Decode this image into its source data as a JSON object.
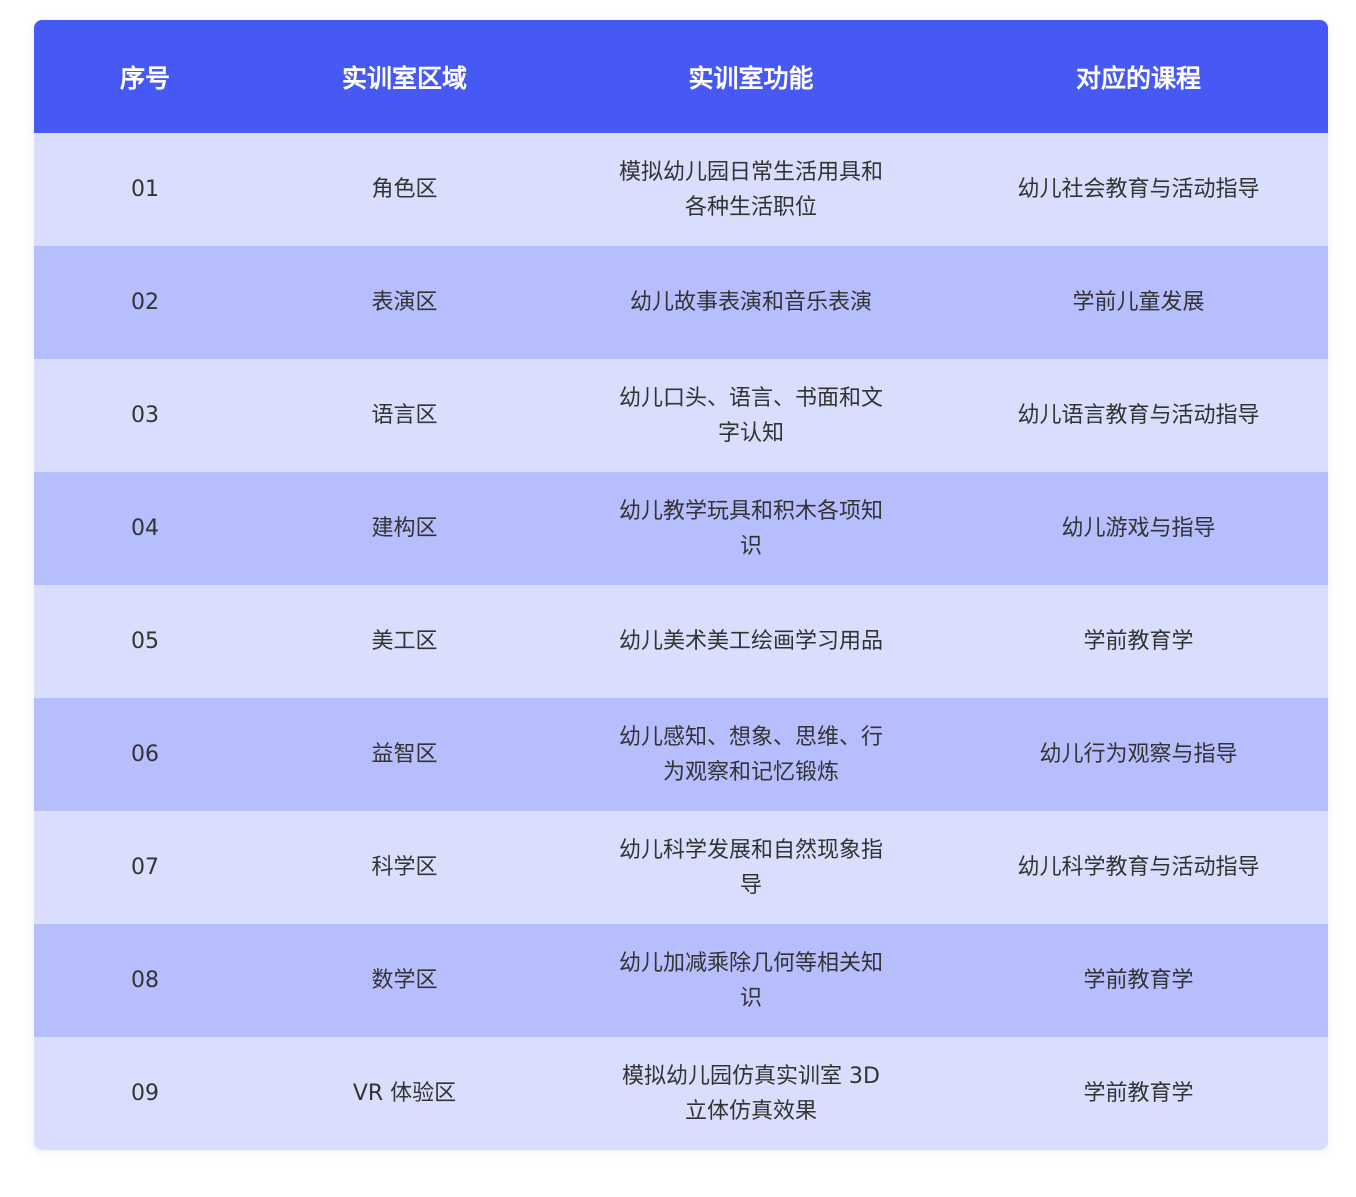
{
  "header": {
    "col_index": "序号",
    "col_area": "实训室区域",
    "col_function": "实训室功能",
    "col_course": "对应的课程"
  },
  "rows": [
    {
      "index": "01",
      "area": "角色区",
      "function": "模拟幼儿园日常生活用具和各种生活职位",
      "course": "幼儿社会教育与活动指导"
    },
    {
      "index": "02",
      "area": "表演区",
      "function": "幼儿故事表演和音乐表演",
      "course": "学前儿童发展"
    },
    {
      "index": "03",
      "area": "语言区",
      "function": "幼儿口头、语言、书面和文字认知",
      "course": "幼儿语言教育与活动指导"
    },
    {
      "index": "04",
      "area": "建构区",
      "function": "幼儿教学玩具和积木各项知识",
      "course": "幼儿游戏与指导"
    },
    {
      "index": "05",
      "area": "美工区",
      "function": "幼儿美术美工绘画学习用品",
      "course": "学前教育学"
    },
    {
      "index": "06",
      "area": "益智区",
      "function": "幼儿感知、想象、思维、行为观察和记忆锻炼",
      "course": "幼儿行为观察与指导"
    },
    {
      "index": "07",
      "area": "科学区",
      "function": "幼儿科学发展和自然现象指导",
      "course": "幼儿科学教育与活动指导"
    },
    {
      "index": "08",
      "area": "数学区",
      "function": "幼儿加减乘除几何等相关知识",
      "course": "学前教育学"
    },
    {
      "index": "09",
      "area": "VR 体验区",
      "function": "模拟幼儿园仿真实训室 3D 立体仿真效果",
      "course": "学前教育学"
    }
  ],
  "colors": {
    "header_bg": "#4759f5",
    "row_light": "#dadefd",
    "row_dark": "#b6befd",
    "text": "#333333"
  }
}
